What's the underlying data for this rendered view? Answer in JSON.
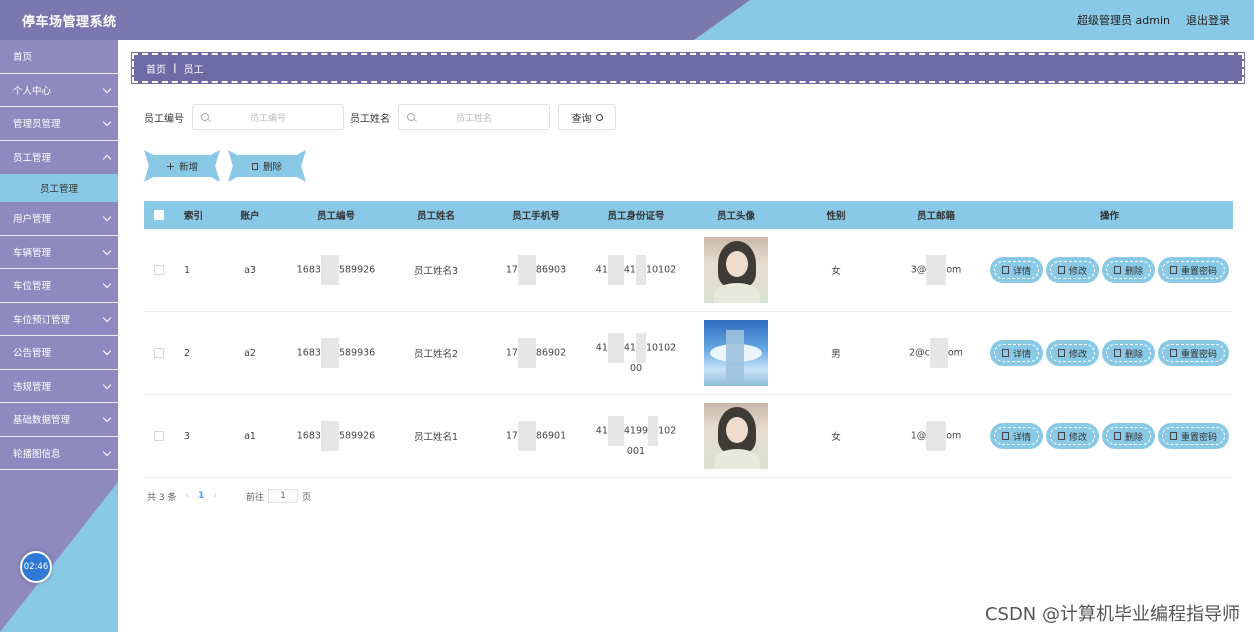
{
  "header": {
    "title": "停车场管理系统",
    "user": "超级管理员 admin",
    "logout": "退出登录"
  },
  "sidebar": {
    "items": [
      {
        "label": "首页",
        "has_arrow": false
      },
      {
        "label": "个人中心",
        "has_arrow": true
      },
      {
        "label": "管理员管理",
        "has_arrow": true
      },
      {
        "label": "员工管理",
        "has_arrow": true
      },
      {
        "label": "员工管理",
        "sub": true
      },
      {
        "label": "用户管理",
        "has_arrow": true
      },
      {
        "label": "车辆管理",
        "has_arrow": true
      },
      {
        "label": "车位管理",
        "has_arrow": true
      },
      {
        "label": "车位预订管理",
        "has_arrow": true
      },
      {
        "label": "公告管理",
        "has_arrow": true
      },
      {
        "label": "违规管理",
        "has_arrow": true
      },
      {
        "label": "基础数据管理",
        "has_arrow": true
      },
      {
        "label": "轮播图信息",
        "has_arrow": true
      }
    ],
    "timer": "02:46"
  },
  "breadcrumb": {
    "home": "首页",
    "sep": "|",
    "current": "员工"
  },
  "search": {
    "field1_label": "员工编号",
    "field1_placeholder": "员工编号",
    "field2_label": "员工姓名",
    "field2_placeholder": "员工姓名",
    "query_label": "查询"
  },
  "toolbar": {
    "add_label": "新增",
    "delete_label": "删除",
    "add_icon": "plus-icon",
    "delete_icon": "trash-icon"
  },
  "table": {
    "headers": [
      "索引",
      "账户",
      "员工编号",
      "员工姓名",
      "员工手机号",
      "员工身份证号",
      "员工头像",
      "性别",
      "员工邮箱",
      "操作"
    ],
    "rows": [
      {
        "index": "1",
        "account": "a3",
        "no_a": "1683",
        "no_b": "589926",
        "name": "员工姓名3",
        "tel_a": "17",
        "tel_b": "86903",
        "id_a": "41",
        "id_b": "41",
        "id_c": "10102",
        "id_d": "",
        "avatar": "girl",
        "sex": "女",
        "mail_a": "3@",
        "mail_b": "om"
      },
      {
        "index": "2",
        "account": "a2",
        "no_a": "1683",
        "no_b": "589936",
        "name": "员工姓名2",
        "tel_a": "17",
        "tel_b": "86902",
        "id_a": "41",
        "id_b": "41",
        "id_c": "10102",
        "id_d": "00",
        "avatar": "sky",
        "sex": "男",
        "mail_a": "2@c",
        "mail_b": "om"
      },
      {
        "index": "3",
        "account": "a1",
        "no_a": "1683",
        "no_b": "589926",
        "name": "员工姓名1",
        "tel_a": "17",
        "tel_b": "86901",
        "id_a": "41",
        "id_b": "4199",
        "id_c": "102",
        "id_d": "001",
        "avatar": "girl",
        "sex": "女",
        "mail_a": "1@",
        "mail_b": "om"
      }
    ],
    "op_labels": {
      "detail": "详情",
      "edit": "修改",
      "delete": "删除",
      "reset": "重置密码"
    }
  },
  "pagination": {
    "total": "共 3 条",
    "page": "1",
    "goto_label": "前往",
    "goto_value": "1",
    "page_suffix": "页"
  },
  "watermark": "CSDN @计算机毕业编程指导师",
  "colors": {
    "header": "#7b78b0",
    "accent": "#8ac9e6",
    "sidebar": "#8e8ac0",
    "crumb": "#6e6aa6"
  }
}
